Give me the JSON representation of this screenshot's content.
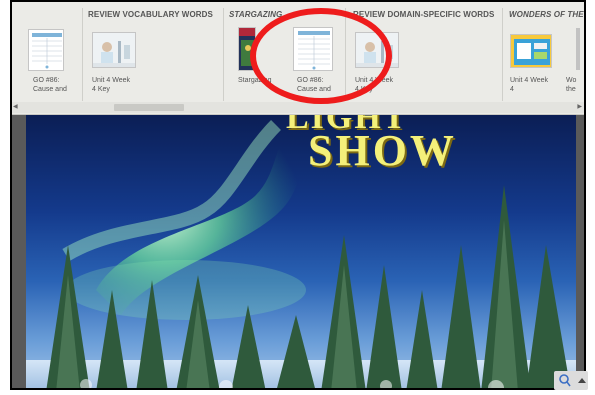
{
  "carousel": {
    "group_headers": [
      "REVIEW VOCABULARY WORDS",
      "STARGAZING",
      "REVIEW DOMAIN-SPECIFIC WORDS",
      "WONDERS OF THE"
    ],
    "items": [
      {
        "caption_line1": "GO #86:",
        "caption_line2": "Cause and"
      },
      {
        "caption_line1": "Unit 4 Week",
        "caption_line2": "4 Key"
      },
      {
        "caption_line1": "Stargazing",
        "caption_line2": ""
      },
      {
        "caption_line1": "GO #86:",
        "caption_line2": "Cause and"
      },
      {
        "caption_line1": "Unit 4 Week",
        "caption_line2": "4 Key"
      },
      {
        "caption_line1": "Unit 4 Week",
        "caption_line2": "4"
      },
      {
        "caption_line1": "Wo",
        "caption_line2": "the"
      }
    ],
    "scroll_left_arrow": "◀",
    "scroll_right_arrow": "▶"
  },
  "page": {
    "title_line1": "LIGHT",
    "title_line2": "SHOW"
  },
  "colors": {
    "highlight_circle": "#ee1c1c",
    "title_text": "#f4f07a"
  }
}
